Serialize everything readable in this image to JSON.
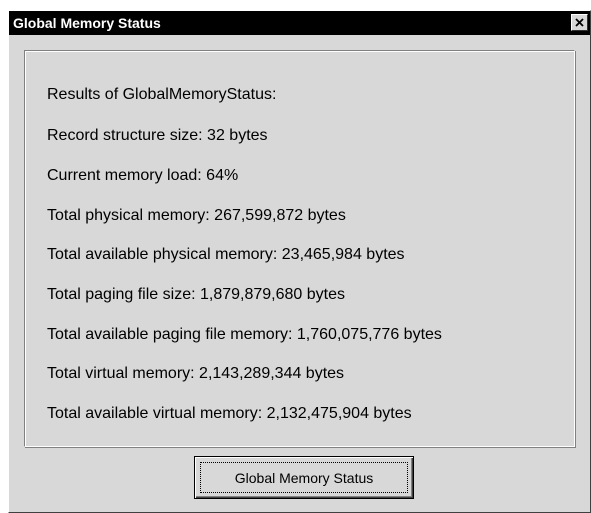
{
  "window": {
    "title": "Global Memory Status"
  },
  "results": {
    "lines": [
      "Results of GlobalMemoryStatus:",
      "Record structure size: 32 bytes",
      "Current memory load: 64%",
      "Total physical memory: 267,599,872 bytes",
      "Total available physical memory: 23,465,984 bytes",
      "Total paging file size: 1,879,879,680 bytes",
      "Total available paging file memory: 1,760,075,776 bytes",
      "Total virtual memory: 2,143,289,344 bytes",
      "Total available virtual memory: 2,132,475,904 bytes"
    ]
  },
  "button": {
    "label": "Global Memory Status"
  },
  "icons": {
    "close": "close-icon"
  },
  "colors": {
    "titlebar": "#000000",
    "face": "#d8d8d8"
  }
}
